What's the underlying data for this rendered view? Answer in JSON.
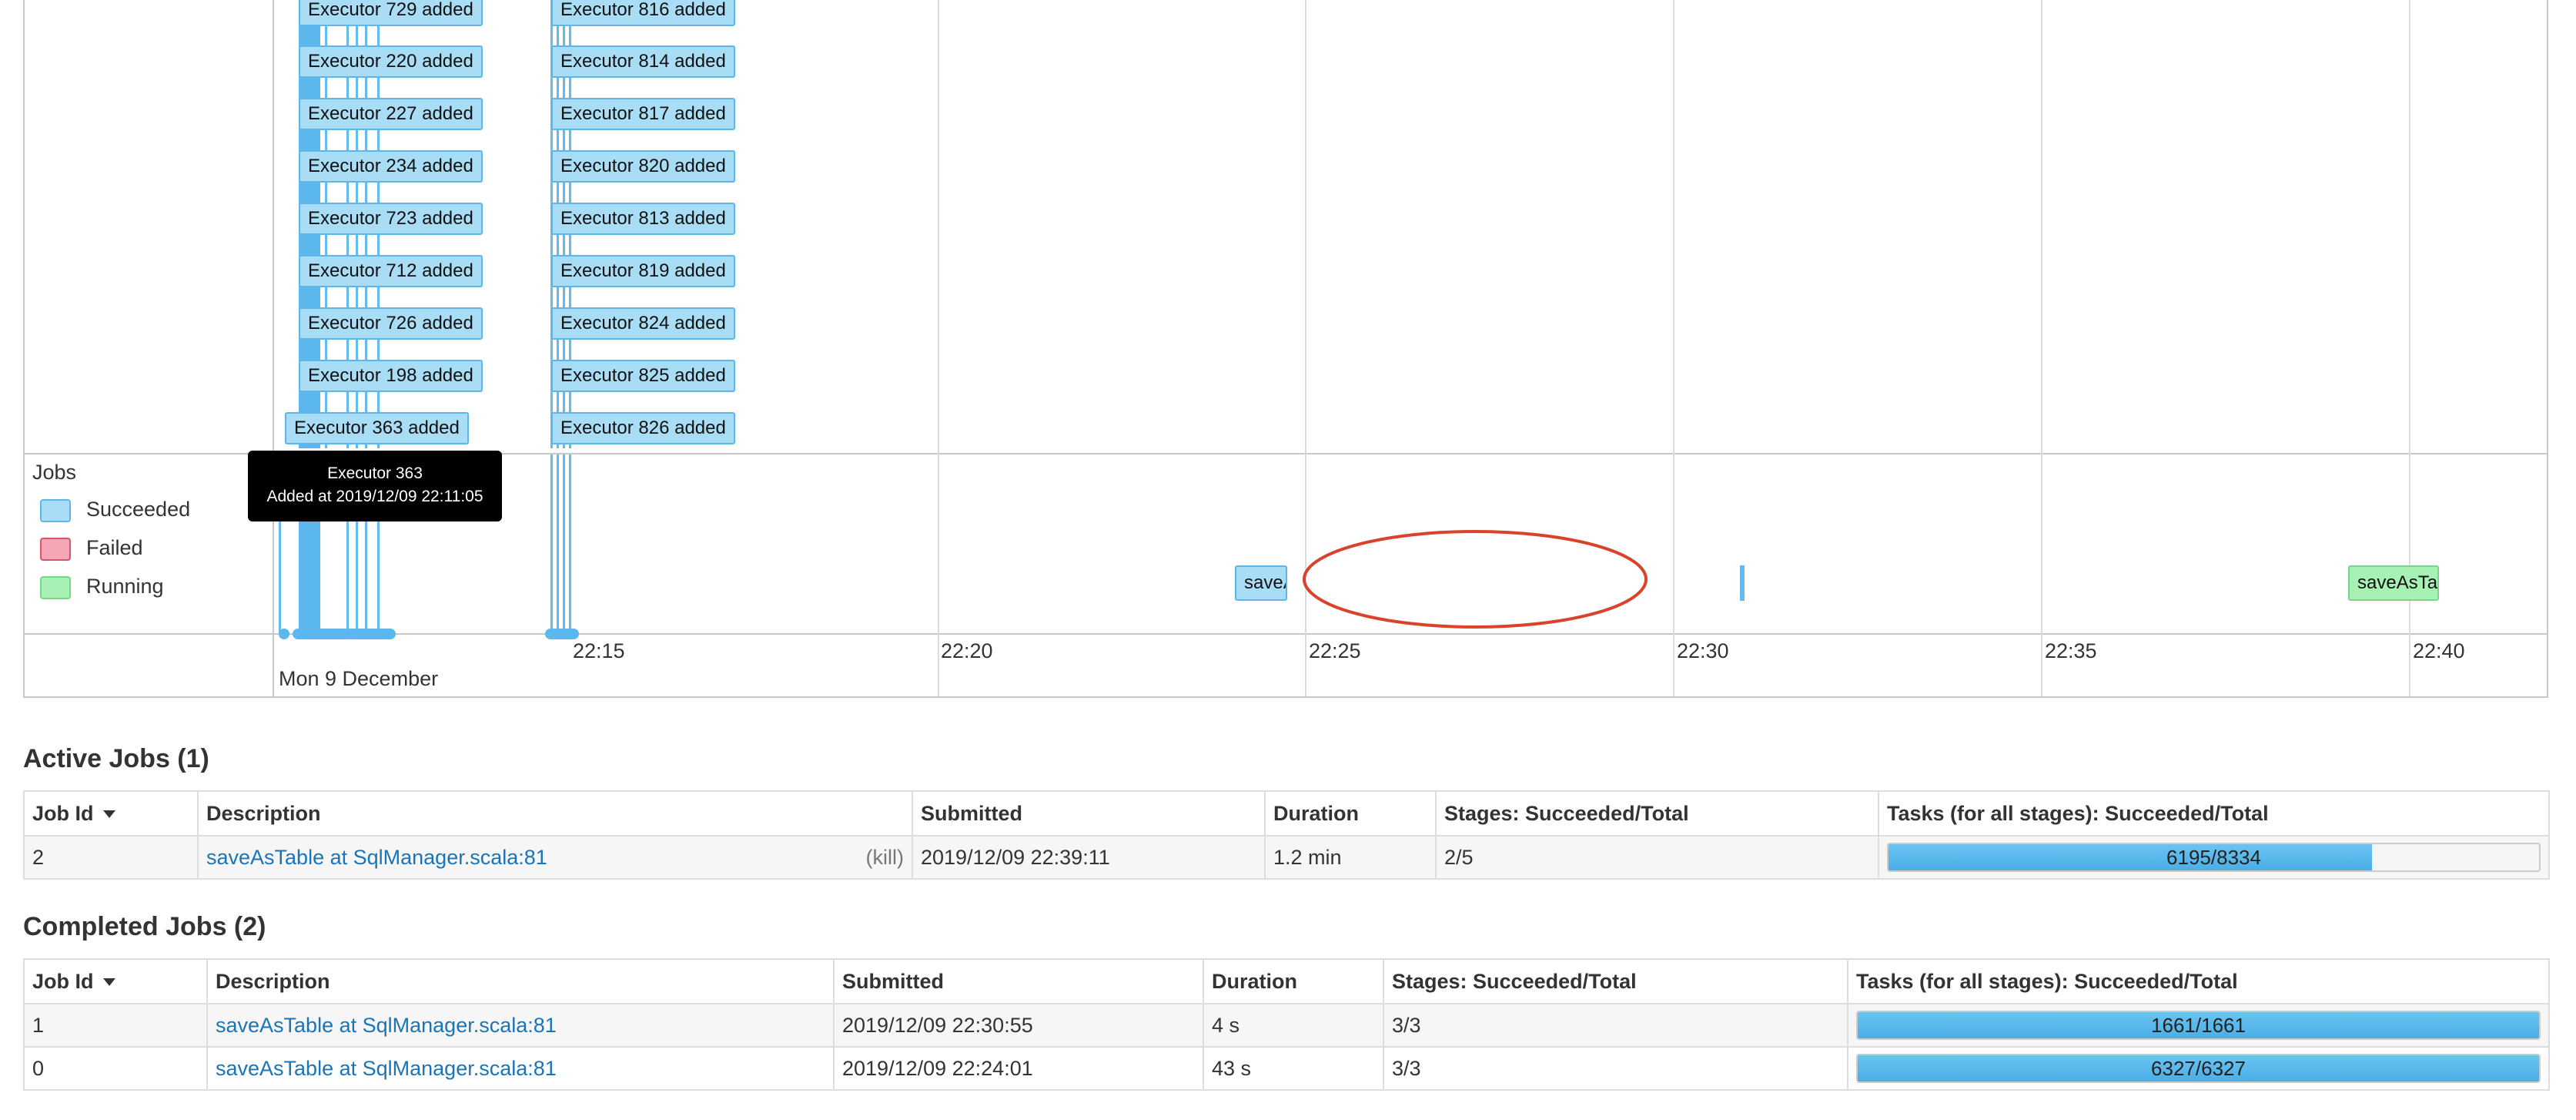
{
  "timeline": {
    "executors_left": [
      "Executor 729 added",
      "Executor 220 added",
      "Executor 227 added",
      "Executor 234 added",
      "Executor 723 added",
      "Executor 712 added",
      "Executor 726 added",
      "Executor 198 added"
    ],
    "executor_highlighted": "Executor 363 added",
    "executors_right": [
      "Executor 816 added",
      "Executor 814 added",
      "Executor 817 added",
      "Executor 820 added",
      "Executor 813 added",
      "Executor 819 added",
      "Executor 824 added",
      "Executor 825 added",
      "Executor 826 added"
    ],
    "legend": {
      "title": "Jobs",
      "items": [
        {
          "label": "Succeeded",
          "color": "#a9ddf6",
          "border": "#5fb6e8"
        },
        {
          "label": "Failed",
          "color": "#f7a6b5",
          "border": "#d9546a"
        },
        {
          "label": "Running",
          "color": "#a7f1b4",
          "border": "#77d488"
        }
      ]
    },
    "tooltip": {
      "line1": "Executor 363",
      "line2": "Added at 2019/12/09 22:11:05"
    },
    "job_labels": {
      "job0": "saveA",
      "job2": "saveAsTa"
    },
    "ticks": [
      "22:15",
      "22:20",
      "22:25",
      "22:30",
      "22:35",
      "22:40"
    ],
    "date_label": "Mon 9 December",
    "annotation_color": "#d9432b"
  },
  "active_jobs": {
    "title": "Active Jobs (1)",
    "headers": [
      "Job Id",
      "Description",
      "Submitted",
      "Duration",
      "Stages: Succeeded/Total",
      "Tasks (for all stages): Succeeded/Total"
    ],
    "rows": [
      {
        "id": "2",
        "description": "saveAsTable at SqlManager.scala:81",
        "kill": "(kill)",
        "submitted": "2019/12/09 22:39:11",
        "duration": "1.2 min",
        "stages": "2/5",
        "tasks": "6195/8334",
        "progress": 0.743
      }
    ]
  },
  "completed_jobs": {
    "title": "Completed Jobs (2)",
    "headers": [
      "Job Id",
      "Description",
      "Submitted",
      "Duration",
      "Stages: Succeeded/Total",
      "Tasks (for all stages): Succeeded/Total"
    ],
    "rows": [
      {
        "id": "1",
        "description": "saveAsTable at SqlManager.scala:81",
        "submitted": "2019/12/09 22:30:55",
        "duration": "4 s",
        "stages": "3/3",
        "tasks": "1661/1661",
        "progress": 1.0
      },
      {
        "id": "0",
        "description": "saveAsTable at SqlManager.scala:81",
        "submitted": "2019/12/09 22:24:01",
        "duration": "43 s",
        "stages": "3/3",
        "tasks": "6327/6327",
        "progress": 1.0
      }
    ]
  }
}
